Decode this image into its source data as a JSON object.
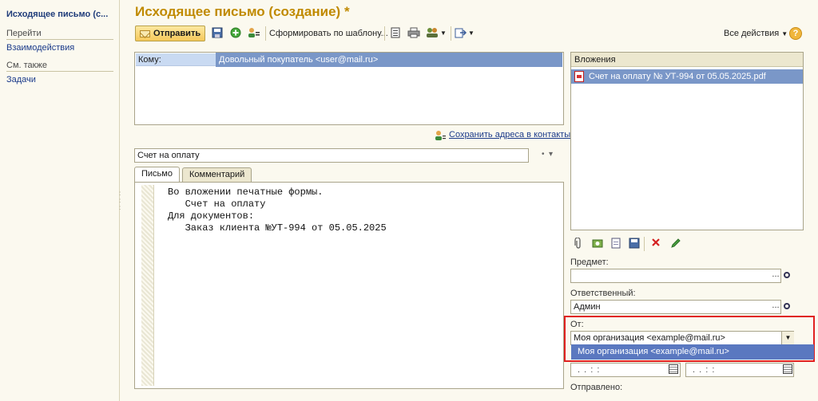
{
  "window": {
    "title": "Исходящее письмо (создание) *"
  },
  "left_panel": {
    "title": "Исходящее письмо (с...",
    "goto_header": "Перейти",
    "goto_items": [
      "Взаимодействия"
    ],
    "see_also_header": "См. также",
    "see_also_items": [
      "Задачи"
    ]
  },
  "toolbar": {
    "send_label": "Отправить",
    "template_label": "Сформировать по шаблону...",
    "all_actions_label": "Все действия",
    "help_label": "?"
  },
  "recipients": {
    "label": "Кому:",
    "value": "Довольный покупатель <user@mail.ru>",
    "save_contacts_label": "Сохранить адреса в контакты"
  },
  "subject": {
    "value": "Счет на оплату"
  },
  "tabs": [
    {
      "label": "Письмо"
    },
    {
      "label": "Комментарий"
    }
  ],
  "editor": {
    "text": "Во вложении печатные формы.\n   Счет на оплату\nДля документов:\n   Заказ клиента №УТ-994 от 05.05.2025"
  },
  "attachments": {
    "header": "Вложения",
    "items": [
      "Счет на оплату № УТ-994 от 05.05.2025.pdf"
    ]
  },
  "fields": {
    "subject_label": "Предмет:",
    "subject_value": "",
    "responsible_label": "Ответственный:",
    "responsible_value": "Админ",
    "from_label": "От:",
    "from_value": "Моя организация <example@mail.ru>",
    "from_options": [
      "Моя организация <example@mail.ru>"
    ],
    "date_placeholder": ". .   : :",
    "sent_label": "Отправлено:"
  },
  "colors": {
    "title": "#c08a00",
    "selection": "#7a97c8",
    "highlight_border": "#e02020"
  }
}
